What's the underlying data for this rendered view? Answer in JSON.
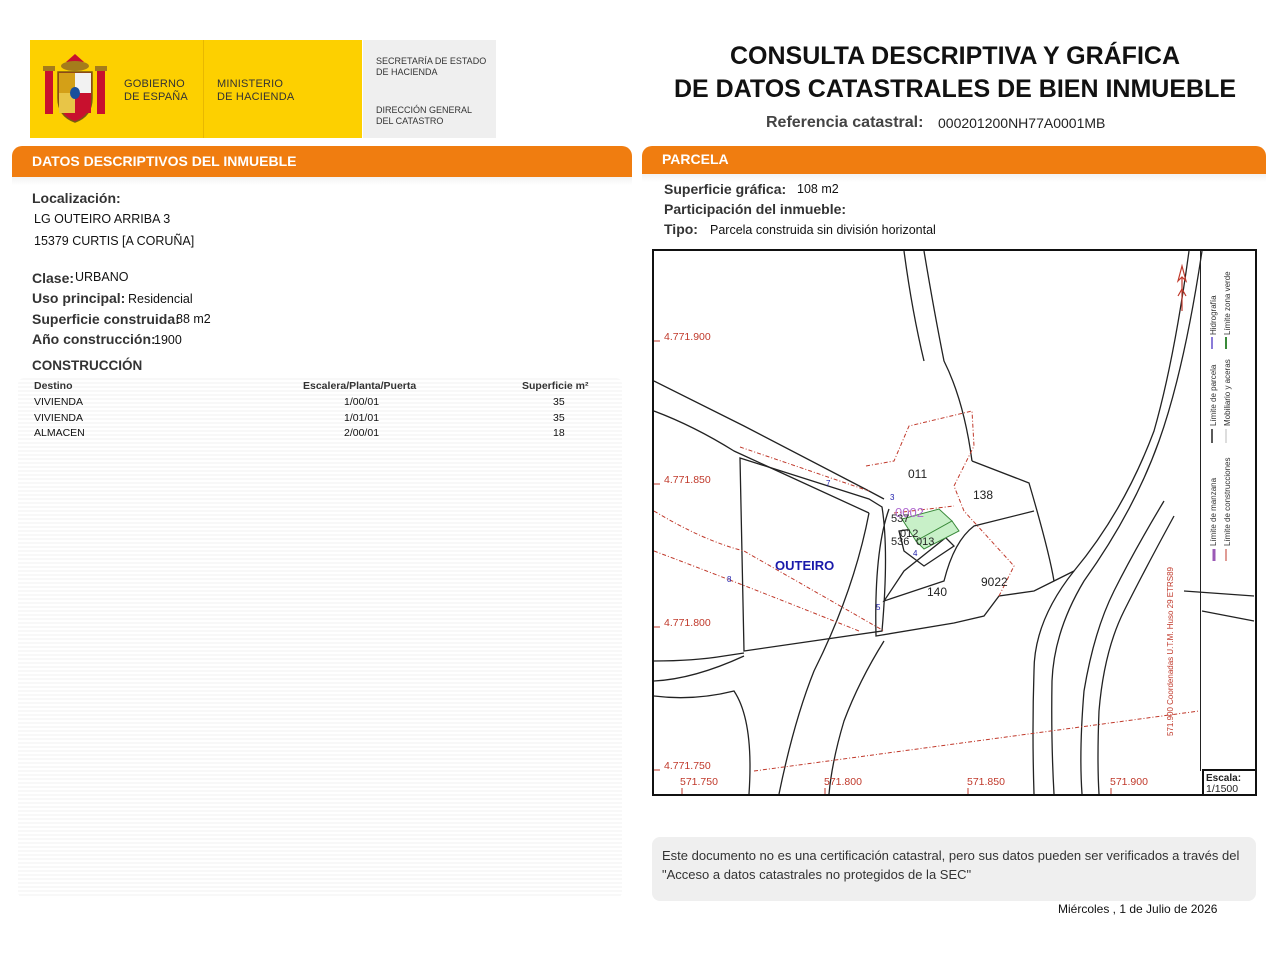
{
  "header": {
    "gobierno": [
      "GOBIERNO",
      "DE ESPAÑA"
    ],
    "ministerio": [
      "MINISTERIO",
      "DE HACIENDA"
    ],
    "secretaria": [
      "SECRETARÍA DE ESTADO",
      "DE HACIENDA"
    ],
    "direccion": [
      "DIRECCIÓN GENERAL",
      "DEL CATASTRO"
    ],
    "title_line1": "CONSULTA DESCRIPTIVA Y GRÁFICA",
    "title_line2": "DE DATOS CATASTRALES DE BIEN INMUEBLE",
    "ref_label": "Referencia catastral:",
    "ref_value": "000201200NH77A0001MB"
  },
  "left": {
    "section_title": "DATOS DESCRIPTIVOS DEL INMUEBLE",
    "localizacion_label": "Localización:",
    "address_line1": "LG OUTEIRO ARRIBA 3",
    "address_line2": "15379 CURTIS [A CORUÑA]",
    "clase_label": "Clase:",
    "clase_value": "URBANO",
    "uso_label": "Uso principal:",
    "uso_value": "Residencial",
    "superficie_label": "Superficie construida:",
    "superficie_value": "88 m2",
    "anio_label": "Año construcción:",
    "anio_value": "1900",
    "construccion_title": "CONSTRUCCIÓN",
    "table_headers": [
      "Destino",
      "Escalera/Planta/Puerta",
      "Superficie m²"
    ],
    "rows": [
      [
        "VIVIENDA",
        "1/00/01",
        "35"
      ],
      [
        "VIVIENDA",
        "1/01/01",
        "35"
      ],
      [
        "ALMACEN",
        "2/00/01",
        "18"
      ]
    ]
  },
  "right": {
    "section_title": "PARCELA",
    "sup_grafica_label": "Superficie gráfica:",
    "sup_grafica_value": "108 m2",
    "participacion_label": "Participación del inmueble:",
    "tipo_label": "Tipo:",
    "tipo_value": "Parcela construida sin división horizontal"
  },
  "map": {
    "y_labels": [
      "4.771.900",
      "4.771.850",
      "4.771.800",
      "4.771.750"
    ],
    "x_labels": [
      "571.750",
      "571.800",
      "571.850",
      "571.900"
    ],
    "place_name": "OUTEIRO",
    "parcels": [
      "011",
      "138",
      "140",
      "9022",
      "0002",
      "537",
      "012",
      "536",
      "013"
    ],
    "street_numbers": [
      "7",
      "3",
      "4",
      "8",
      "5"
    ],
    "legend": {
      "limite_manzana": "Límite de manzana",
      "limite_parcela": "Límite de parcela",
      "hidrografia": "Hidrografía",
      "limite_construcciones": "Límite de construcciones",
      "mobiliario": "Mobiliario y aceras",
      "zona_verde": "Límite zona verde",
      "coords": "571.900 Coordenadas U.T.M. Huso 29 ETRS89"
    },
    "scale_label": "Escala:",
    "scale_value": "1/1500"
  },
  "footer": {
    "note": "Este documento no es una certificación catastral, pero sus datos pueden ser verificados a través del \"Acceso a datos catastrales no protegidos de la SEC\"",
    "date": "Miércoles , 1 de Julio de 2026"
  },
  "colors": {
    "orange": "#f07d10",
    "yellow": "#fdd000",
    "coord_red": "#c0392b",
    "parcel_blue": "#1a1aaa"
  }
}
